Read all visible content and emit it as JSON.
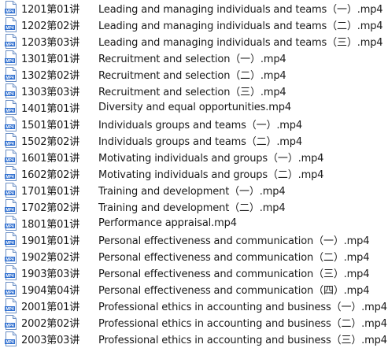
{
  "files": [
    {
      "code": "1201第01讲",
      "name": "Leading and managing individuals and teams（一）.mp4",
      "icon": "mp4-file-icon"
    },
    {
      "code": "1202第02讲",
      "name": "Leading and managing individuals and teams（二）.mp4",
      "icon": "mp4-file-icon"
    },
    {
      "code": "1203第03讲",
      "name": "Leading and managing individuals and teams（三）.mp4",
      "icon": "mp4-file-icon"
    },
    {
      "code": "1301第01讲",
      "name": "Recruitment and selection（一）.mp4",
      "icon": "mp4-file-icon"
    },
    {
      "code": "1302第02讲",
      "name": "Recruitment and selection（二）.mp4",
      "icon": "mp4-file-icon"
    },
    {
      "code": "1303第03讲",
      "name": "Recruitment and selection（三）.mp4",
      "icon": "mp4-file-icon"
    },
    {
      "code": "1401第01讲",
      "name": "Diversity and equal opportunities.mp4",
      "icon": "mp4-file-icon"
    },
    {
      "code": "1501第01讲",
      "name": "Individuals groups and teams（一）.mp4",
      "icon": "mp4-file-icon"
    },
    {
      "code": "1502第02讲",
      "name": "Individuals groups and teams（二）.mp4",
      "icon": "mp4-file-icon"
    },
    {
      "code": "1601第01讲",
      "name": "Motivating individuals and groups（一）.mp4",
      "icon": "mp4-file-icon"
    },
    {
      "code": "1602第02讲",
      "name": "Motivating individuals and groups（二）.mp4",
      "icon": "mp4-file-icon"
    },
    {
      "code": "1701第01讲",
      "name": "Training and development（一）.mp4",
      "icon": "mp4-file-icon"
    },
    {
      "code": "1702第02讲",
      "name": "Training and development（二）.mp4",
      "icon": "mp4-file-icon"
    },
    {
      "code": "1801第01讲",
      "name": "Performance appraisal.mp4",
      "icon": "mp4-file-icon"
    },
    {
      "code": "1901第01讲",
      "name": "Personal effectiveness and communication（一）.mp4",
      "icon": "mp4-file-icon"
    },
    {
      "code": "1902第02讲",
      "name": "Personal effectiveness and communication（二）.mp4",
      "icon": "mp4-file-icon"
    },
    {
      "code": "1903第03讲",
      "name": "Personal effectiveness and communication（三）.mp4",
      "icon": "mp4-file-icon"
    },
    {
      "code": "1904第04讲",
      "name": "Personal effectiveness and communication（四）.mp4",
      "icon": "mp4-file-icon"
    },
    {
      "code": "2001第01讲",
      "name": "Professional ethics in accounting and business（一）.mp4",
      "icon": "mp4-file-icon"
    },
    {
      "code": "2002第02讲",
      "name": "Professional ethics in accounting and business（二）.mp4",
      "icon": "mp4-file-icon"
    },
    {
      "code": "2003第03讲",
      "name": "Professional ethics in accounting and business（三）.mp4",
      "icon": "mp4-file-icon"
    }
  ],
  "icon_label": "MP4",
  "colors": {
    "icon_border": "#6b8fc4",
    "icon_badge": "#2f6fd0",
    "text": "#1a1a1a"
  }
}
